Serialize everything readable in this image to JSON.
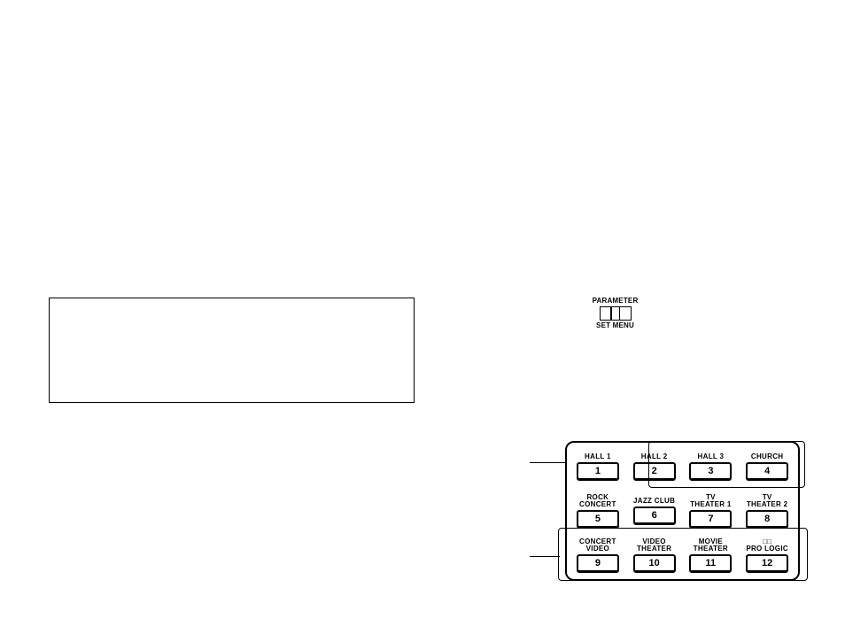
{
  "main_note_box": {
    "text": ""
  },
  "parameter_switch": {
    "top_label": "PARAMETER",
    "bottom_label": "SET MENU"
  },
  "button_panel": {
    "rows": [
      [
        {
          "label": "HALL 1",
          "num": "1"
        },
        {
          "label": "HALL 2",
          "num": "2"
        },
        {
          "label": "HALL 3",
          "num": "3"
        },
        {
          "label": "CHURCH",
          "num": "4"
        }
      ],
      [
        {
          "label": "ROCK\nCONCERT",
          "num": "5"
        },
        {
          "label": "JAZZ CLUB",
          "num": "6"
        },
        {
          "label": "TV\nTHEATER 1",
          "num": "7"
        },
        {
          "label": "TV\nTHEATER 2",
          "num": "8"
        }
      ],
      [
        {
          "label": "CONCERT\nVIDEO",
          "num": "9"
        },
        {
          "label": "VIDEO\nTHEATER",
          "num": "10"
        },
        {
          "label": "MOVIE\nTHEATER",
          "num": "11"
        },
        {
          "label": "□□\nPRO LOGIC",
          "num": "12"
        }
      ]
    ]
  }
}
